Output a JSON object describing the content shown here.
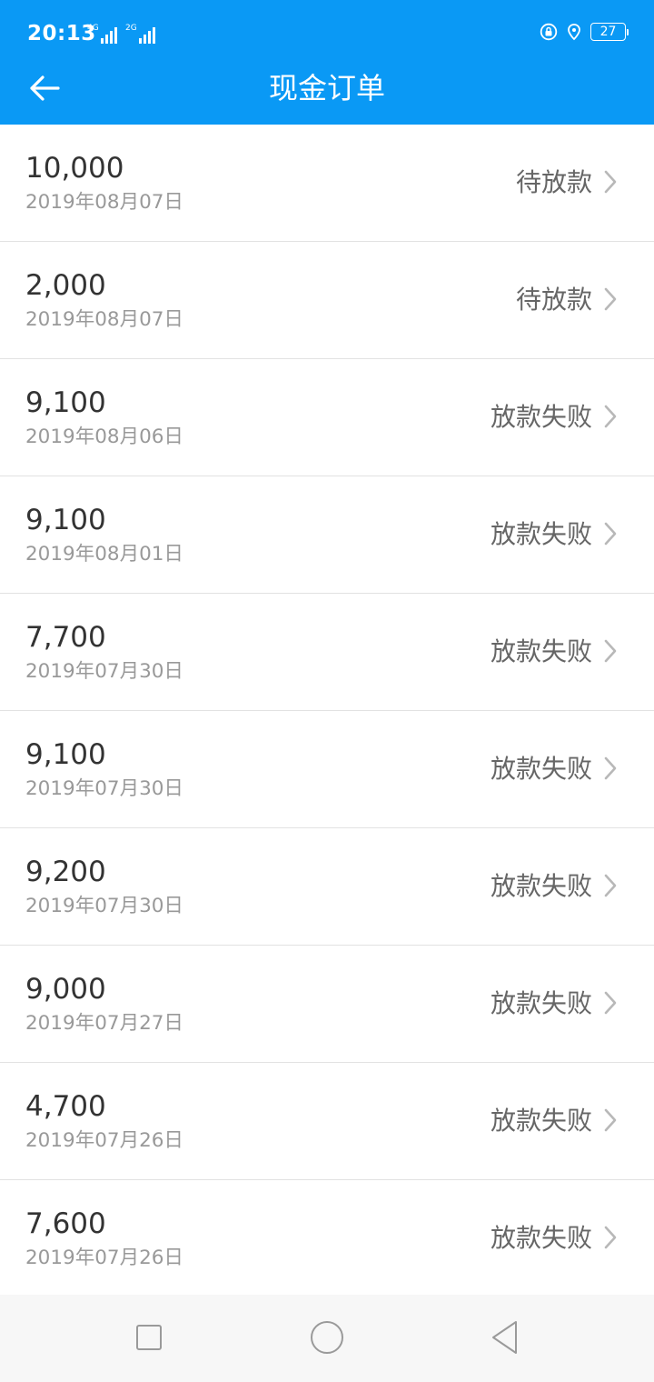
{
  "status_bar": {
    "time": "20:13",
    "signal_1_label": "4G",
    "signal_2_label": "2G",
    "battery": "27"
  },
  "header": {
    "title": "现金订单",
    "background_color": "#0a99f5"
  },
  "orders": [
    {
      "amount": "10,000",
      "date": "2019年08月07日",
      "status": "待放款"
    },
    {
      "amount": "2,000",
      "date": "2019年08月07日",
      "status": "待放款"
    },
    {
      "amount": "9,100",
      "date": "2019年08月06日",
      "status": "放款失败"
    },
    {
      "amount": "9,100",
      "date": "2019年08月01日",
      "status": "放款失败"
    },
    {
      "amount": "7,700",
      "date": "2019年07月30日",
      "status": "放款失败"
    },
    {
      "amount": "9,100",
      "date": "2019年07月30日",
      "status": "放款失败"
    },
    {
      "amount": "9,200",
      "date": "2019年07月30日",
      "status": "放款失败"
    },
    {
      "amount": "9,000",
      "date": "2019年07月27日",
      "status": "放款失败"
    },
    {
      "amount": "4,700",
      "date": "2019年07月26日",
      "status": "放款失败"
    },
    {
      "amount": "7,600",
      "date": "2019年07月26日",
      "status": "放款失败"
    }
  ],
  "icons": {
    "back": "arrow-left-icon",
    "row_chevron": "chevron-right-icon",
    "nav_recent": "square-icon",
    "nav_home": "circle-icon",
    "nav_back": "triangle-back-icon",
    "status_lock": "rotation-lock-icon",
    "status_location": "location-icon"
  }
}
